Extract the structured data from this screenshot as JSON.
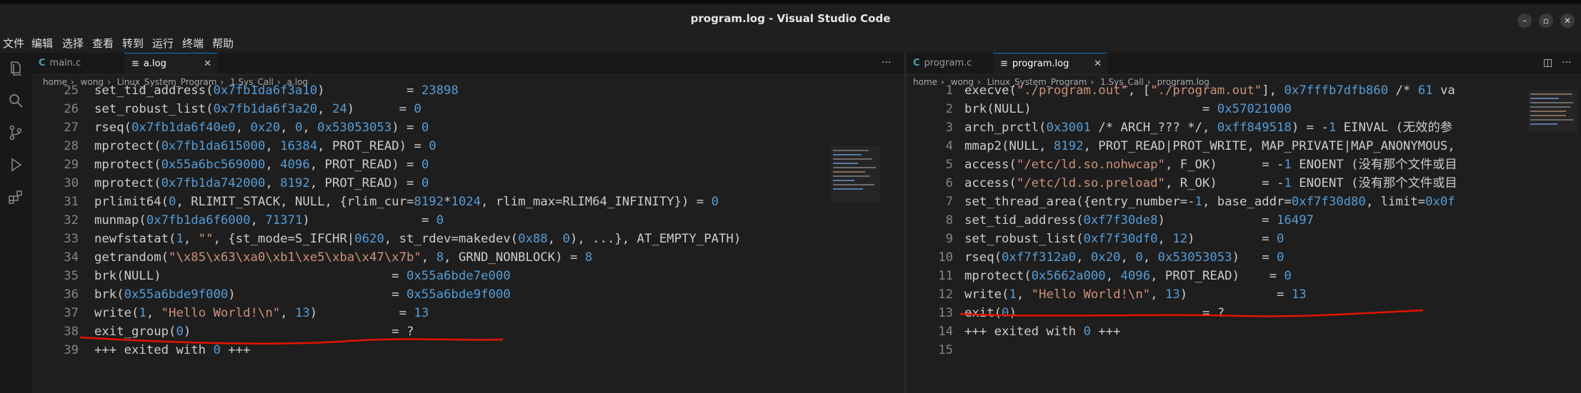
{
  "window": {
    "title": "program.log - Visual Studio Code"
  },
  "menu": [
    "文件",
    "编辑",
    "选择",
    "查看",
    "转到",
    "运行",
    "终端",
    "帮助"
  ],
  "left_editor": {
    "tabs": [
      {
        "icon": "C",
        "label": "main.c",
        "active": false
      },
      {
        "icon": "≡",
        "label": "a.log",
        "active": true
      }
    ],
    "breadcrumb": [
      "home",
      "wong",
      "Linux_System_Program",
      "1.Sys_Call",
      "a.log"
    ],
    "lines": [
      {
        "no": "25",
        "segs": [
          [
            "t",
            "set_tid_address("
          ],
          [
            "n",
            "0x7fb1da6f3a10"
          ],
          [
            "t",
            ")           = "
          ],
          [
            "n",
            "23898"
          ]
        ]
      },
      {
        "no": "26",
        "segs": [
          [
            "t",
            "set_robust_list("
          ],
          [
            "n",
            "0x7fb1da6f3a20"
          ],
          [
            "t",
            ", "
          ],
          [
            "n",
            "24"
          ],
          [
            "t",
            ")      = "
          ],
          [
            "n",
            "0"
          ]
        ]
      },
      {
        "no": "27",
        "segs": [
          [
            "t",
            "rseq("
          ],
          [
            "n",
            "0x7fb1da6f40e0"
          ],
          [
            "t",
            ", "
          ],
          [
            "n",
            "0x20"
          ],
          [
            "t",
            ", "
          ],
          [
            "n",
            "0"
          ],
          [
            "t",
            ", "
          ],
          [
            "n",
            "0x53053053"
          ],
          [
            "t",
            ") = "
          ],
          [
            "n",
            "0"
          ]
        ]
      },
      {
        "no": "28",
        "segs": [
          [
            "t",
            "mprotect("
          ],
          [
            "n",
            "0x7fb1da615000"
          ],
          [
            "t",
            ", "
          ],
          [
            "n",
            "16384"
          ],
          [
            "t",
            ", PROT_READ) = "
          ],
          [
            "n",
            "0"
          ]
        ]
      },
      {
        "no": "29",
        "segs": [
          [
            "t",
            "mprotect("
          ],
          [
            "n",
            "0x55a6bc569000"
          ],
          [
            "t",
            ", "
          ],
          [
            "n",
            "4096"
          ],
          [
            "t",
            ", PROT_READ) = "
          ],
          [
            "n",
            "0"
          ]
        ]
      },
      {
        "no": "30",
        "segs": [
          [
            "t",
            "mprotect("
          ],
          [
            "n",
            "0x7fb1da742000"
          ],
          [
            "t",
            ", "
          ],
          [
            "n",
            "8192"
          ],
          [
            "t",
            ", PROT_READ) = "
          ],
          [
            "n",
            "0"
          ]
        ]
      },
      {
        "no": "31",
        "segs": [
          [
            "t",
            "prlimit64("
          ],
          [
            "n",
            "0"
          ],
          [
            "t",
            ", RLIMIT_STACK, NULL, {rlim_cur="
          ],
          [
            "n",
            "8192"
          ],
          [
            "t",
            "*"
          ],
          [
            "n",
            "1024"
          ],
          [
            "t",
            ", rlim_max=RLIM64_INFINITY}) = "
          ],
          [
            "n",
            "0"
          ]
        ]
      },
      {
        "no": "32",
        "segs": [
          [
            "t",
            "munmap("
          ],
          [
            "n",
            "0x7fb1da6f6000"
          ],
          [
            "t",
            ", "
          ],
          [
            "n",
            "71371"
          ],
          [
            "t",
            ")               = "
          ],
          [
            "n",
            "0"
          ]
        ]
      },
      {
        "no": "33",
        "segs": [
          [
            "t",
            "newfstatat("
          ],
          [
            "n",
            "1"
          ],
          [
            "t",
            ", "
          ],
          [
            "s",
            "\"\""
          ],
          [
            "t",
            ", {st_mode=S_IFCHR|"
          ],
          [
            "n",
            "0620"
          ],
          [
            "t",
            ", st_rdev=makedev("
          ],
          [
            "n",
            "0x88"
          ],
          [
            "t",
            ", "
          ],
          [
            "n",
            "0"
          ],
          [
            "t",
            "), ...}, AT_EMPTY_PATH)"
          ]
        ]
      },
      {
        "no": "34",
        "segs": [
          [
            "t",
            "getrandom("
          ],
          [
            "s",
            "\"\\x85\\x63\\xa0\\xb1\\xe5\\xba\\x47\\x7b\""
          ],
          [
            "t",
            ", "
          ],
          [
            "n",
            "8"
          ],
          [
            "t",
            ", GRND_NONBLOCK) = "
          ],
          [
            "n",
            "8"
          ]
        ]
      },
      {
        "no": "35",
        "segs": [
          [
            "t",
            "brk(NULL)                               = "
          ],
          [
            "n",
            "0x55a6bde7e000"
          ]
        ]
      },
      {
        "no": "36",
        "segs": [
          [
            "t",
            "brk("
          ],
          [
            "n",
            "0x55a6bde9f000"
          ],
          [
            "t",
            ")                     = "
          ],
          [
            "n",
            "0x55a6bde9f000"
          ]
        ]
      },
      {
        "no": "37",
        "segs": [
          [
            "t",
            "write("
          ],
          [
            "n",
            "1"
          ],
          [
            "t",
            ", "
          ],
          [
            "s",
            "\"Hello World!\\n\""
          ],
          [
            "t",
            ", "
          ],
          [
            "n",
            "13"
          ],
          [
            "t",
            ")           = "
          ],
          [
            "n",
            "13"
          ]
        ]
      },
      {
        "no": "38",
        "segs": [
          [
            "t",
            "exit_group("
          ],
          [
            "n",
            "0"
          ],
          [
            "t",
            ")                           = ?"
          ]
        ]
      },
      {
        "no": "39",
        "segs": [
          [
            "t",
            "+++ exited with "
          ],
          [
            "n",
            "0"
          ],
          [
            "t",
            " +++"
          ]
        ]
      }
    ]
  },
  "right_editor": {
    "tabs": [
      {
        "icon": "C",
        "label": "program.c",
        "active": false
      },
      {
        "icon": "≡",
        "label": "program.log",
        "active": true
      }
    ],
    "breadcrumb": [
      "home",
      "wong",
      "Linux_System_Program",
      "1.Sys_Call",
      "program.log"
    ],
    "lines": [
      {
        "no": "1",
        "segs": [
          [
            "t",
            "execve("
          ],
          [
            "s",
            "\"./program.out\""
          ],
          [
            "t",
            ", ["
          ],
          [
            "s",
            "\"./program.out\""
          ],
          [
            "t",
            "], "
          ],
          [
            "n",
            "0x7fffb7dfb860"
          ],
          [
            "t",
            " /* "
          ],
          [
            "n",
            "61"
          ],
          [
            "t",
            " va"
          ]
        ]
      },
      {
        "no": "2",
        "segs": [
          [
            "t",
            "brk(NULL)                       = "
          ],
          [
            "n",
            "0x57021000"
          ]
        ]
      },
      {
        "no": "3",
        "segs": [
          [
            "t",
            "arch_prctl("
          ],
          [
            "n",
            "0x3001"
          ],
          [
            "t",
            " /* ARCH_??? */, "
          ],
          [
            "n",
            "0xff849518"
          ],
          [
            "t",
            ") = -"
          ],
          [
            "n",
            "1"
          ],
          [
            "t",
            " EINVAL (无效的参"
          ]
        ]
      },
      {
        "no": "4",
        "segs": [
          [
            "t",
            "mmap2(NULL, "
          ],
          [
            "n",
            "8192"
          ],
          [
            "t",
            ", PROT_READ|PROT_WRITE, MAP_PRIVATE|MAP_ANONYMOUS,"
          ]
        ]
      },
      {
        "no": "5",
        "segs": [
          [
            "t",
            "access("
          ],
          [
            "s",
            "\"/etc/ld.so.nohwcap\""
          ],
          [
            "t",
            ", F_OK)      = -"
          ],
          [
            "n",
            "1"
          ],
          [
            "t",
            " ENOENT (没有那个文件或目"
          ]
        ]
      },
      {
        "no": "6",
        "segs": [
          [
            "t",
            "access("
          ],
          [
            "s",
            "\"/etc/ld.so.preload\""
          ],
          [
            "t",
            ", R_OK)      = -"
          ],
          [
            "n",
            "1"
          ],
          [
            "t",
            " ENOENT (没有那个文件或目"
          ]
        ]
      },
      {
        "no": "7",
        "segs": [
          [
            "t",
            "set_thread_area({entry_number=-"
          ],
          [
            "n",
            "1"
          ],
          [
            "t",
            ", base_addr="
          ],
          [
            "n",
            "0xf7f30d80"
          ],
          [
            "t",
            ", limit="
          ],
          [
            "n",
            "0x0f"
          ]
        ]
      },
      {
        "no": "8",
        "segs": [
          [
            "t",
            "set_tid_address("
          ],
          [
            "n",
            "0xf7f30de8"
          ],
          [
            "t",
            ")             = "
          ],
          [
            "n",
            "16497"
          ]
        ]
      },
      {
        "no": "9",
        "segs": [
          [
            "t",
            "set_robust_list("
          ],
          [
            "n",
            "0xf7f30df0"
          ],
          [
            "t",
            ", "
          ],
          [
            "n",
            "12"
          ],
          [
            "t",
            ")         = "
          ],
          [
            "n",
            "0"
          ]
        ]
      },
      {
        "no": "10",
        "segs": [
          [
            "t",
            "rseq("
          ],
          [
            "n",
            "0xf7f312a0"
          ],
          [
            "t",
            ", "
          ],
          [
            "n",
            "0x20"
          ],
          [
            "t",
            ", "
          ],
          [
            "n",
            "0"
          ],
          [
            "t",
            ", "
          ],
          [
            "n",
            "0x53053053"
          ],
          [
            "t",
            ")   = "
          ],
          [
            "n",
            "0"
          ]
        ]
      },
      {
        "no": "11",
        "segs": [
          [
            "t",
            "mprotect("
          ],
          [
            "n",
            "0x5662a000"
          ],
          [
            "t",
            ", "
          ],
          [
            "n",
            "4096"
          ],
          [
            "t",
            ", PROT_READ)    = "
          ],
          [
            "n",
            "0"
          ]
        ]
      },
      {
        "no": "12",
        "segs": [
          [
            "t",
            "write("
          ],
          [
            "n",
            "1"
          ],
          [
            "t",
            ", "
          ],
          [
            "s",
            "\"Hello World!\\n\""
          ],
          [
            "t",
            ", "
          ],
          [
            "n",
            "13"
          ],
          [
            "t",
            ")            = "
          ],
          [
            "n",
            "13"
          ]
        ]
      },
      {
        "no": "13",
        "segs": [
          [
            "t",
            "exit("
          ],
          [
            "n",
            "0"
          ],
          [
            "t",
            ")                         = ?"
          ]
        ]
      },
      {
        "no": "14",
        "segs": [
          [
            "t",
            "+++ exited with "
          ],
          [
            "n",
            "0"
          ],
          [
            "t",
            " +++"
          ]
        ]
      },
      {
        "no": "15",
        "segs": []
      }
    ]
  },
  "colors": {
    "number": "#569cd6",
    "string": "#ce9178",
    "text": "#cccccc",
    "annotation": "#e51400",
    "accent": "#0078d4"
  }
}
